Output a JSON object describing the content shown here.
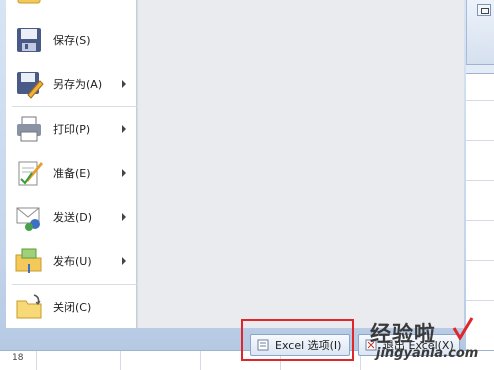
{
  "menu": {
    "items": [
      {
        "label": "另存为(",
        "hotkey": "S",
        "tail": ")",
        "name": "save",
        "icon": "floppy-disk-icon"
      },
      {
        "label": "另存为(",
        "hotkey": "A",
        "tail": ")",
        "name": "save-as",
        "icon": "save-as-icon"
      },
      {
        "label": "打印(",
        "hotkey": "P",
        "tail": ")",
        "name": "print",
        "icon": "printer-icon"
      },
      {
        "label": "准备(",
        "hotkey": "E",
        "tail": ")",
        "name": "prepare",
        "icon": "prepare-document-icon"
      },
      {
        "label": "发送(",
        "hotkey": "D",
        "tail": ")",
        "name": "send",
        "icon": "send-email-icon"
      },
      {
        "label": "发布(",
        "hotkey": "U",
        "tail": ")",
        "name": "publish",
        "icon": "publish-folder-icon"
      },
      {
        "label": "关闭(",
        "hotkey": "C",
        "tail": ")",
        "name": "close",
        "icon": "close-folder-icon"
      }
    ],
    "save_label": "保存(S)",
    "save_as_label": "另存为(A)",
    "print_label": "打印(P)",
    "prepare_label": "准备(E)",
    "send_label": "发送(D)",
    "publish_label": "发布(U)",
    "close_label": "关闭(C)"
  },
  "buttons": {
    "options_label": "Excel 选项(I)",
    "exit_label": "退出 Excel(X)"
  },
  "watermark": {
    "line1": "经验啦",
    "line2": "jingyanla.com"
  },
  "sheet": {
    "row_number": "18"
  },
  "colors": {
    "highlight": "#e0262a",
    "panel": "#c4d5ec"
  }
}
